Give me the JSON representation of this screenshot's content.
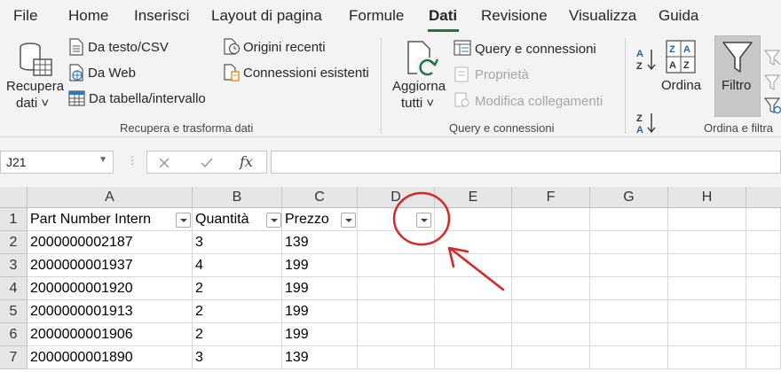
{
  "menu": {
    "tabs": [
      "File",
      "Home",
      "Inserisci",
      "Layout di pagina",
      "Formule",
      "Dati",
      "Revisione",
      "Visualizza",
      "Guida"
    ],
    "active": "Dati"
  },
  "ribbon": {
    "recupera_line1": "Recupera",
    "recupera_line2": "dati ˅",
    "da_testo": "Da testo/CSV",
    "da_web": "Da Web",
    "da_tabella": "Da tabella/intervallo",
    "origini_recenti": "Origini recenti",
    "connessioni_esistenti": "Connessioni esistenti",
    "group1_label": "Recupera e trasforma dati",
    "aggiorna_line1": "Aggiorna",
    "aggiorna_line2": "tutti ˅",
    "query_connessioni": "Query e connessioni",
    "proprieta": "Proprietà",
    "modifica_collegamenti": "Modifica collegamenti",
    "group2_label": "Query e connessioni",
    "ordina": "Ordina",
    "filtro": "Filtro",
    "group3_label": "Ordina e filtra"
  },
  "formula_bar": {
    "name_box": "J21",
    "fx": "fx",
    "formula": ""
  },
  "sheet": {
    "columns": [
      "A",
      "B",
      "C",
      "D",
      "E",
      "F",
      "G",
      "H"
    ],
    "rows": [
      "1",
      "2",
      "3",
      "4",
      "5",
      "6",
      "7"
    ],
    "headers": [
      "Part Number Intern",
      "Quantità",
      "Prezzo"
    ],
    "data": [
      [
        "2000000002187",
        "3",
        "139"
      ],
      [
        "2000000001937",
        "4",
        "199"
      ],
      [
        "2000000001920",
        "2",
        "199"
      ],
      [
        "2000000001913",
        "2",
        "199"
      ],
      [
        "2000000001906",
        "2",
        "199"
      ],
      [
        "2000000001890",
        "3",
        "139"
      ]
    ]
  },
  "colors": {
    "accent": "#217346",
    "annotation": "#d9262a"
  }
}
